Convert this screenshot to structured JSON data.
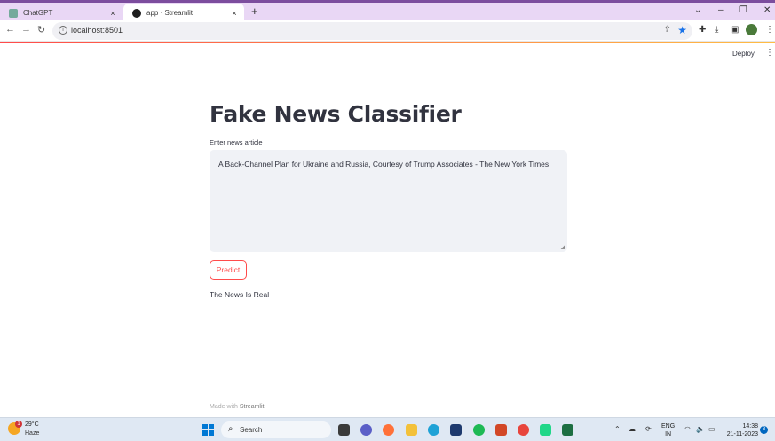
{
  "browser": {
    "tabs": [
      {
        "label": "ChatGPT",
        "active": false,
        "favicon_color": "#74aa9c"
      },
      {
        "label": "app · Streamlit",
        "active": true,
        "favicon_color": "#1e1e1e"
      }
    ],
    "close_glyph": "×",
    "new_tab_glyph": "+",
    "window_controls": {
      "minimize": "–",
      "restore": "❐",
      "close": "✕",
      "chevron": "⌄"
    },
    "url": "localhost:8501"
  },
  "app": {
    "deploy_label": "Deploy",
    "title": "Fake News Classifier",
    "input_label": "Enter news article",
    "input_value": "A Back-Channel Plan for Ukraine and Russia, Courtesy of Trump Associates - The New York Times",
    "predict_label": "Predict",
    "result": "The News Is Real",
    "footer_prefix": "Made with",
    "footer_brand": "Streamlit",
    "accent_color": "#ff4b4b"
  },
  "taskbar": {
    "weather_temp": "29°C",
    "weather_condition": "Haze",
    "weather_badge": "1",
    "search_label": "Search",
    "lang_line1": "ENG",
    "lang_line2": "IN",
    "time": "14:38",
    "date": "21-11-2023",
    "notification_count": "3"
  }
}
